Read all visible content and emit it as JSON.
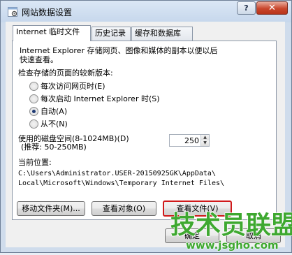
{
  "window": {
    "title": "网站数据设置",
    "help_label": "?",
    "close_label": "✕"
  },
  "tabs": [
    {
      "label": "Internet 临时文件",
      "active": true
    },
    {
      "label": "历史记录",
      "active": false
    },
    {
      "label": "缓存和数据库",
      "active": false
    }
  ],
  "temp_files": {
    "description_line1": "Internet Explorer 存储网页、图像和媒体的副本以便以后",
    "description_line2": "快速查看。",
    "check_newer_label": "检查存储的页面的较新版本:",
    "options": [
      {
        "label": "每次访问网页时(E)",
        "selected": false
      },
      {
        "label": "每次启动 Internet Explorer 时(S)",
        "selected": false
      },
      {
        "label": "自动(A)",
        "selected": true
      },
      {
        "label": "从不(N)",
        "selected": false
      }
    ],
    "disk_space_label": "使用的磁盘空间(8-1024MB)(D)",
    "disk_space_hint": "(推荐: 50-250MB)",
    "disk_space_value": "250",
    "current_location_label": "当前位置:",
    "path_line1": "C:\\Users\\Administrator.USER-20150925GK\\AppData\\",
    "path_line2": "Local\\Microsoft\\Windows\\Temporary Internet Files\\",
    "move_folder_button": "移动文件夹(M)...",
    "view_objects_button": "查看对象(O)",
    "view_files_button": "查看文件(V)"
  },
  "footer": {
    "ok_button": "确定",
    "cancel_button": "取消"
  },
  "watermark": {
    "main_text": "技术员联盟",
    "url_text": "www.jsgho.com"
  },
  "colors": {
    "highlight_border": "#d0191a",
    "watermark_green": "#3ea830"
  },
  "icons": {
    "title_icon": "settings-page-icon"
  }
}
